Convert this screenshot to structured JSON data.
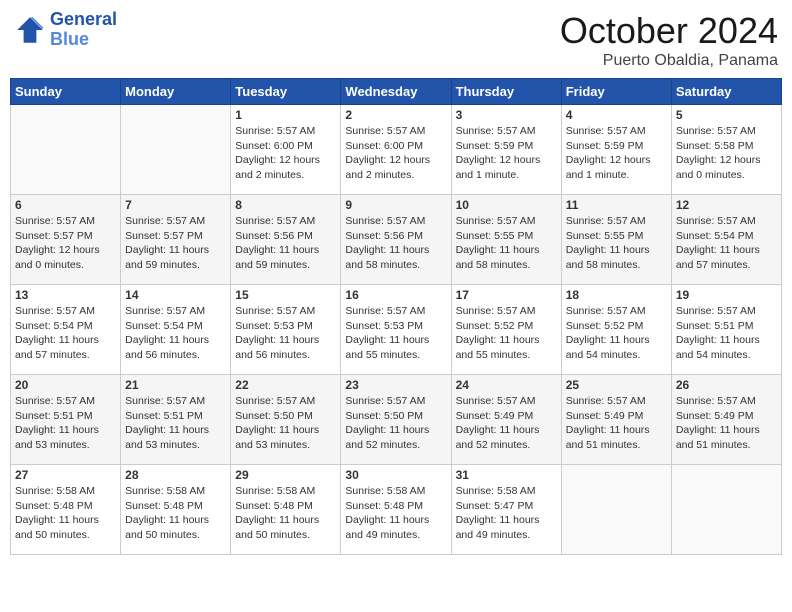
{
  "header": {
    "logo_line1": "General",
    "logo_line2": "Blue",
    "title": "October 2024",
    "subtitle": "Puerto Obaldia, Panama"
  },
  "weekdays": [
    "Sunday",
    "Monday",
    "Tuesday",
    "Wednesday",
    "Thursday",
    "Friday",
    "Saturday"
  ],
  "weeks": [
    [
      {
        "day": "",
        "info": ""
      },
      {
        "day": "",
        "info": ""
      },
      {
        "day": "1",
        "info": "Sunrise: 5:57 AM\nSunset: 6:00 PM\nDaylight: 12 hours\nand 2 minutes."
      },
      {
        "day": "2",
        "info": "Sunrise: 5:57 AM\nSunset: 6:00 PM\nDaylight: 12 hours\nand 2 minutes."
      },
      {
        "day": "3",
        "info": "Sunrise: 5:57 AM\nSunset: 5:59 PM\nDaylight: 12 hours\nand 1 minute."
      },
      {
        "day": "4",
        "info": "Sunrise: 5:57 AM\nSunset: 5:59 PM\nDaylight: 12 hours\nand 1 minute."
      },
      {
        "day": "5",
        "info": "Sunrise: 5:57 AM\nSunset: 5:58 PM\nDaylight: 12 hours\nand 0 minutes."
      }
    ],
    [
      {
        "day": "6",
        "info": "Sunrise: 5:57 AM\nSunset: 5:57 PM\nDaylight: 12 hours\nand 0 minutes."
      },
      {
        "day": "7",
        "info": "Sunrise: 5:57 AM\nSunset: 5:57 PM\nDaylight: 11 hours\nand 59 minutes."
      },
      {
        "day": "8",
        "info": "Sunrise: 5:57 AM\nSunset: 5:56 PM\nDaylight: 11 hours\nand 59 minutes."
      },
      {
        "day": "9",
        "info": "Sunrise: 5:57 AM\nSunset: 5:56 PM\nDaylight: 11 hours\nand 58 minutes."
      },
      {
        "day": "10",
        "info": "Sunrise: 5:57 AM\nSunset: 5:55 PM\nDaylight: 11 hours\nand 58 minutes."
      },
      {
        "day": "11",
        "info": "Sunrise: 5:57 AM\nSunset: 5:55 PM\nDaylight: 11 hours\nand 58 minutes."
      },
      {
        "day": "12",
        "info": "Sunrise: 5:57 AM\nSunset: 5:54 PM\nDaylight: 11 hours\nand 57 minutes."
      }
    ],
    [
      {
        "day": "13",
        "info": "Sunrise: 5:57 AM\nSunset: 5:54 PM\nDaylight: 11 hours\nand 57 minutes."
      },
      {
        "day": "14",
        "info": "Sunrise: 5:57 AM\nSunset: 5:54 PM\nDaylight: 11 hours\nand 56 minutes."
      },
      {
        "day": "15",
        "info": "Sunrise: 5:57 AM\nSunset: 5:53 PM\nDaylight: 11 hours\nand 56 minutes."
      },
      {
        "day": "16",
        "info": "Sunrise: 5:57 AM\nSunset: 5:53 PM\nDaylight: 11 hours\nand 55 minutes."
      },
      {
        "day": "17",
        "info": "Sunrise: 5:57 AM\nSunset: 5:52 PM\nDaylight: 11 hours\nand 55 minutes."
      },
      {
        "day": "18",
        "info": "Sunrise: 5:57 AM\nSunset: 5:52 PM\nDaylight: 11 hours\nand 54 minutes."
      },
      {
        "day": "19",
        "info": "Sunrise: 5:57 AM\nSunset: 5:51 PM\nDaylight: 11 hours\nand 54 minutes."
      }
    ],
    [
      {
        "day": "20",
        "info": "Sunrise: 5:57 AM\nSunset: 5:51 PM\nDaylight: 11 hours\nand 53 minutes."
      },
      {
        "day": "21",
        "info": "Sunrise: 5:57 AM\nSunset: 5:51 PM\nDaylight: 11 hours\nand 53 minutes."
      },
      {
        "day": "22",
        "info": "Sunrise: 5:57 AM\nSunset: 5:50 PM\nDaylight: 11 hours\nand 53 minutes."
      },
      {
        "day": "23",
        "info": "Sunrise: 5:57 AM\nSunset: 5:50 PM\nDaylight: 11 hours\nand 52 minutes."
      },
      {
        "day": "24",
        "info": "Sunrise: 5:57 AM\nSunset: 5:49 PM\nDaylight: 11 hours\nand 52 minutes."
      },
      {
        "day": "25",
        "info": "Sunrise: 5:57 AM\nSunset: 5:49 PM\nDaylight: 11 hours\nand 51 minutes."
      },
      {
        "day": "26",
        "info": "Sunrise: 5:57 AM\nSunset: 5:49 PM\nDaylight: 11 hours\nand 51 minutes."
      }
    ],
    [
      {
        "day": "27",
        "info": "Sunrise: 5:58 AM\nSunset: 5:48 PM\nDaylight: 11 hours\nand 50 minutes."
      },
      {
        "day": "28",
        "info": "Sunrise: 5:58 AM\nSunset: 5:48 PM\nDaylight: 11 hours\nand 50 minutes."
      },
      {
        "day": "29",
        "info": "Sunrise: 5:58 AM\nSunset: 5:48 PM\nDaylight: 11 hours\nand 50 minutes."
      },
      {
        "day": "30",
        "info": "Sunrise: 5:58 AM\nSunset: 5:48 PM\nDaylight: 11 hours\nand 49 minutes."
      },
      {
        "day": "31",
        "info": "Sunrise: 5:58 AM\nSunset: 5:47 PM\nDaylight: 11 hours\nand 49 minutes."
      },
      {
        "day": "",
        "info": ""
      },
      {
        "day": "",
        "info": ""
      }
    ]
  ]
}
